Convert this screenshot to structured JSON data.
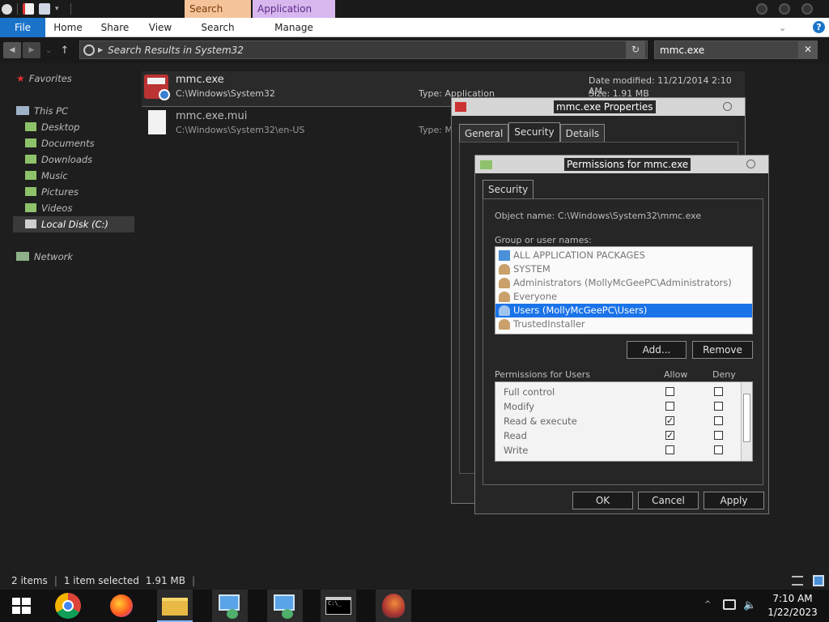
{
  "ribbon": {
    "context_search": "Search Tools",
    "context_app": "Application Tools",
    "tabs": [
      "File",
      "Home",
      "Share",
      "View",
      "Search",
      "Manage"
    ]
  },
  "address": {
    "path": "Search Results in System32",
    "search_value": "mmc.exe"
  },
  "nav": {
    "favorites": "Favorites",
    "this_pc": "This PC",
    "items": [
      "Desktop",
      "Documents",
      "Downloads",
      "Music",
      "Pictures",
      "Videos",
      "Local Disk (C:)"
    ],
    "network": "Network"
  },
  "files": [
    {
      "name": "mmc.exe",
      "path": "C:\\Windows\\System32",
      "type": "Type: Application",
      "date": "Date modified: 11/21/2014 2:10 AM",
      "size": "Size: 1.91 MB"
    },
    {
      "name": "mmc.exe.mui",
      "path": "C:\\Windows\\System32\\en-US",
      "type": "Type: M"
    }
  ],
  "props_dialog": {
    "title": "mmc.exe Properties",
    "tabs": [
      "General",
      "Security",
      "Details"
    ]
  },
  "perm_dialog": {
    "title": "Permissions for mmc.exe",
    "tab": "Security",
    "object_label": "Object name:",
    "object_value": "C:\\Windows\\System32\\mmc.exe",
    "group_label": "Group or user names:",
    "groups": [
      "ALL APPLICATION PACKAGES",
      "SYSTEM",
      "Administrators (MollyMcGeePC\\Administrators)",
      "Everyone",
      "Users (MollyMcGeePC\\Users)",
      "TrustedInstaller"
    ],
    "selected_group_index": 4,
    "add_label": "Add...",
    "remove_label": "Remove",
    "perms_label": "Permissions for Users",
    "allow_label": "Allow",
    "deny_label": "Deny",
    "permissions": [
      {
        "name": "Full control",
        "allow": false,
        "deny": false
      },
      {
        "name": "Modify",
        "allow": false,
        "deny": false
      },
      {
        "name": "Read & execute",
        "allow": true,
        "deny": false
      },
      {
        "name": "Read",
        "allow": true,
        "deny": false
      },
      {
        "name": "Write",
        "allow": false,
        "deny": false
      }
    ],
    "ok_label": "OK",
    "cancel_label": "Cancel",
    "apply_label": "Apply"
  },
  "status": {
    "count": "2 items",
    "selection": "1 item selected",
    "size": "1.91 MB"
  },
  "clock": {
    "time": "7:10 AM",
    "date": "1/22/2023"
  },
  "colors": {
    "accent": "#1a73c9",
    "search_tools_tab": "#f4c39a",
    "app_tools_tab": "#d8b6ee",
    "selection": "#1a73e8"
  }
}
